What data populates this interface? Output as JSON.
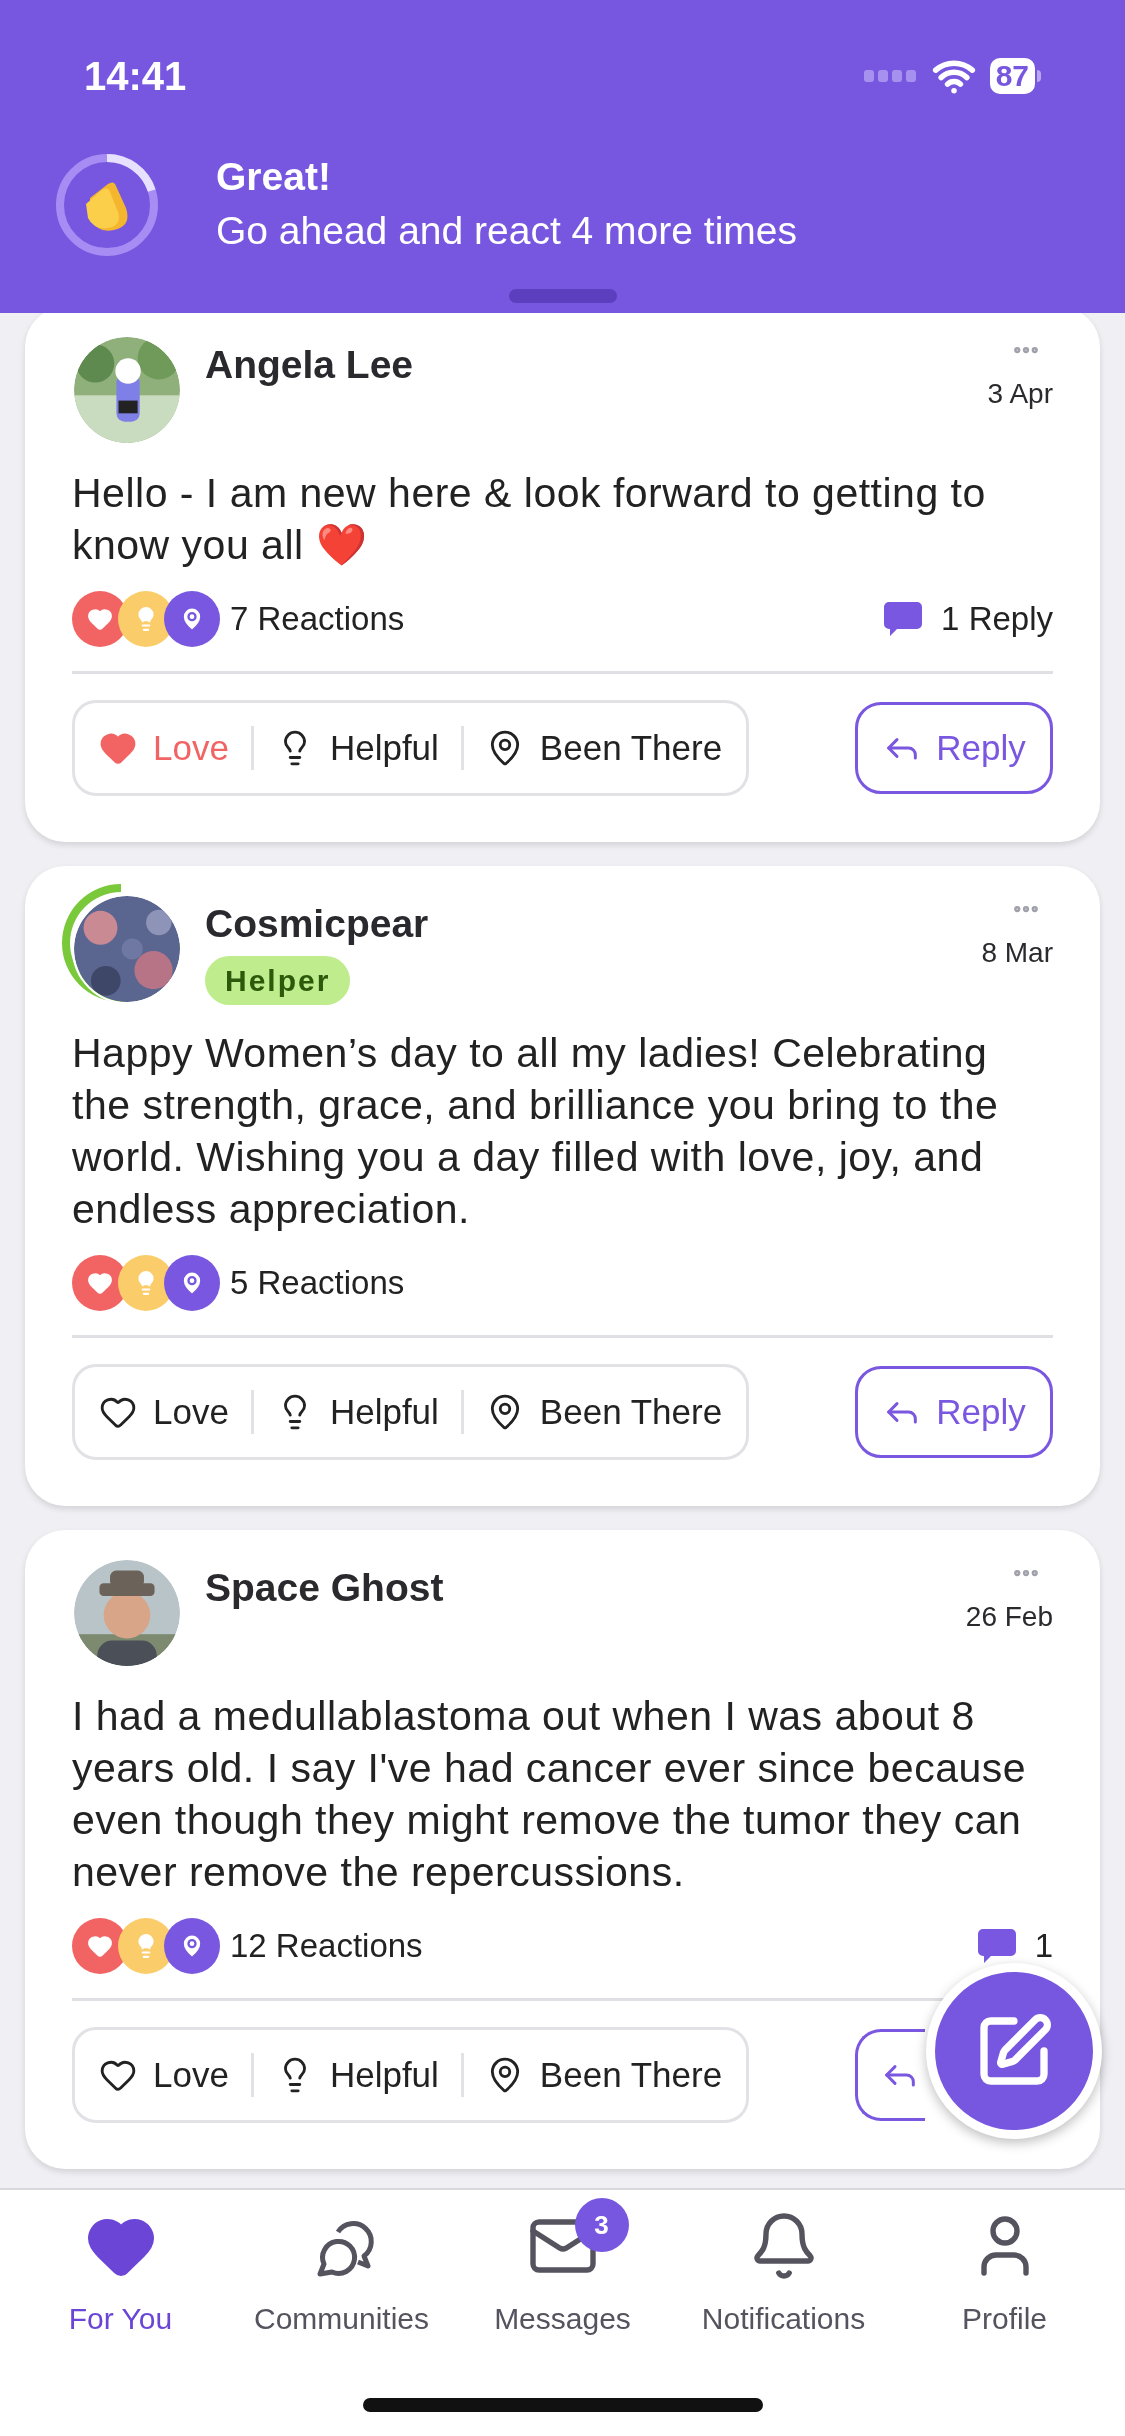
{
  "status_bar": {
    "time": "14:41",
    "battery": "87"
  },
  "banner": {
    "title": "Great!",
    "message": "Go ahead and react 4 more times",
    "level": 0.2
  },
  "posts": [
    {
      "author": "Angela Lee",
      "avatar_ring": false,
      "date": "3 Apr",
      "body": "Hello - I am new here & look forward to getting to know you all ❤️",
      "reactions_summary": "7 Reactions",
      "reply_count": "1 Reply",
      "reactions": [
        {
          "kind": "love",
          "label": "Love",
          "selected": true
        },
        {
          "kind": "helpful",
          "label": "Helpful",
          "selected": false
        },
        {
          "kind": "been_there",
          "label": "Been There",
          "selected": false
        }
      ],
      "reply_button": "Reply"
    },
    {
      "author": "Cosmicpear",
      "avatar_ring": true,
      "badge": "Helper",
      "date": "8 Mar",
      "body": "Happy Women’s day to all my ladies! Celebrating the strength, grace, and brilliance you bring to the world. Wishing you a day filled with love, joy, and endless appreciation.",
      "reactions_summary": "5 Reactions",
      "reactions": [
        {
          "kind": "love",
          "label": "Love",
          "selected": false
        },
        {
          "kind": "helpful",
          "label": "Helpful",
          "selected": false
        },
        {
          "kind": "been_there",
          "label": "Been There",
          "selected": false
        }
      ],
      "reply_button": "Reply"
    },
    {
      "author": "Space Ghost",
      "avatar_ring": false,
      "date": "26 Feb",
      "body": "I had a medullablastoma out when I was about 8 years old. I say I've had cancer ever since because even though they might remove the tumor they can never remove the repercussions.",
      "reactions_summary": "12 Reactions",
      "reply_count": "1",
      "reactions": [
        {
          "kind": "love",
          "label": "Love",
          "selected": false
        },
        {
          "kind": "helpful",
          "label": "Helpful",
          "selected": false
        },
        {
          "kind": "been_there",
          "label": "Been There",
          "selected": false
        }
      ]
    }
  ],
  "nav": [
    {
      "kind": "heart",
      "label": "For You",
      "selected": true
    },
    {
      "kind": "chats",
      "label": "Communities",
      "selected": false
    },
    {
      "kind": "mail",
      "label": "Messages",
      "selected": false,
      "badge": "3"
    },
    {
      "kind": "bell",
      "label": "Notifications",
      "selected": false
    },
    {
      "kind": "person",
      "label": "Profile",
      "selected": false
    }
  ]
}
